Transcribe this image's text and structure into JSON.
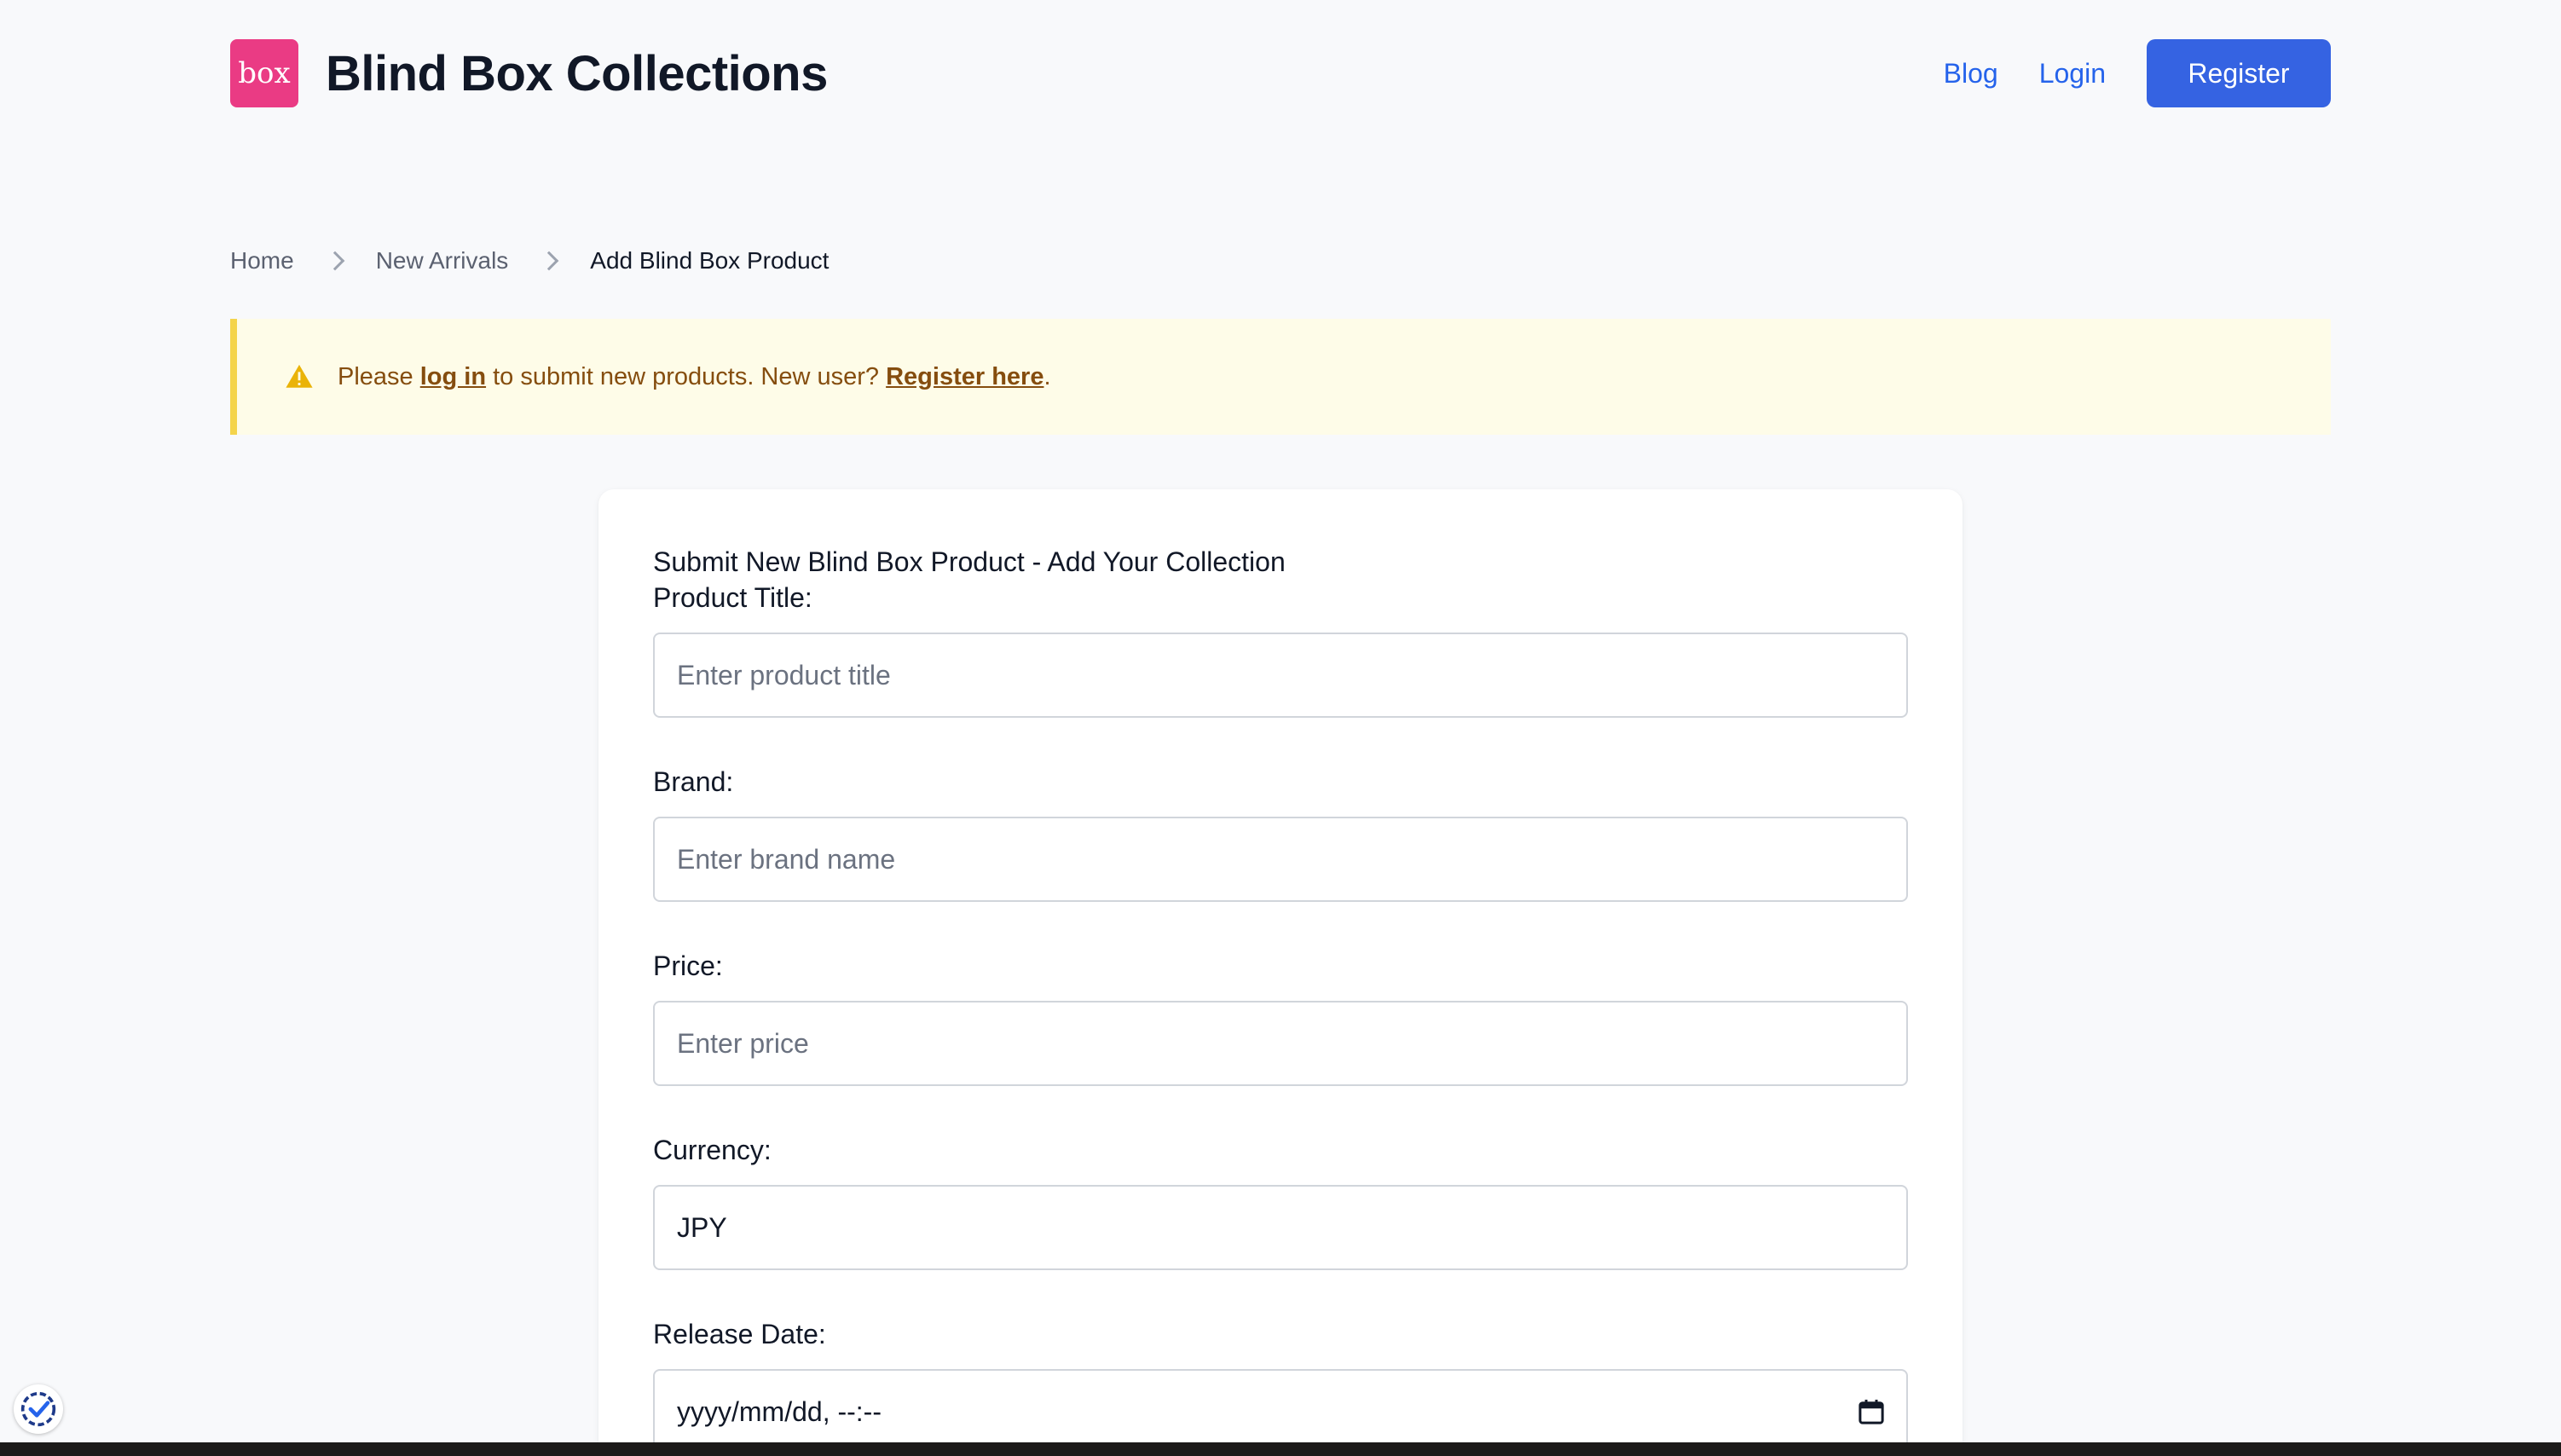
{
  "header": {
    "logo_text": "box",
    "site_title": "Blind Box Collections",
    "nav": {
      "blog": "Blog",
      "login": "Login",
      "register": "Register"
    }
  },
  "breadcrumb": [
    "Home",
    "New Arrivals",
    "Add Blind Box Product"
  ],
  "alert": {
    "icon": "warning-icon",
    "text_before": "Please ",
    "login_link": "log in",
    "text_middle": " to submit new products. New user? ",
    "register_link": "Register here",
    "text_after": "."
  },
  "form": {
    "heading": "Submit New Blind Box Product - Add Your Collection",
    "fields": [
      {
        "label": "Product Title:",
        "placeholder": "Enter product title",
        "value": ""
      },
      {
        "label": "Brand:",
        "placeholder": "Enter brand name",
        "value": ""
      },
      {
        "label": "Price:",
        "placeholder": "Enter price",
        "value": ""
      },
      {
        "label": "Currency:",
        "placeholder": "",
        "value": "JPY"
      },
      {
        "label": "Release Date:",
        "placeholder": "yyyy/mm/dd, --:--",
        "value": "",
        "icon": "calendar-icon"
      }
    ]
  },
  "colors": {
    "accent": "#3563e2",
    "link": "#2563eb",
    "logo_bg": "#ea3b84",
    "alert_bg": "#fefce8",
    "alert_border": "#f4d44b",
    "alert_text": "#854d0e"
  }
}
